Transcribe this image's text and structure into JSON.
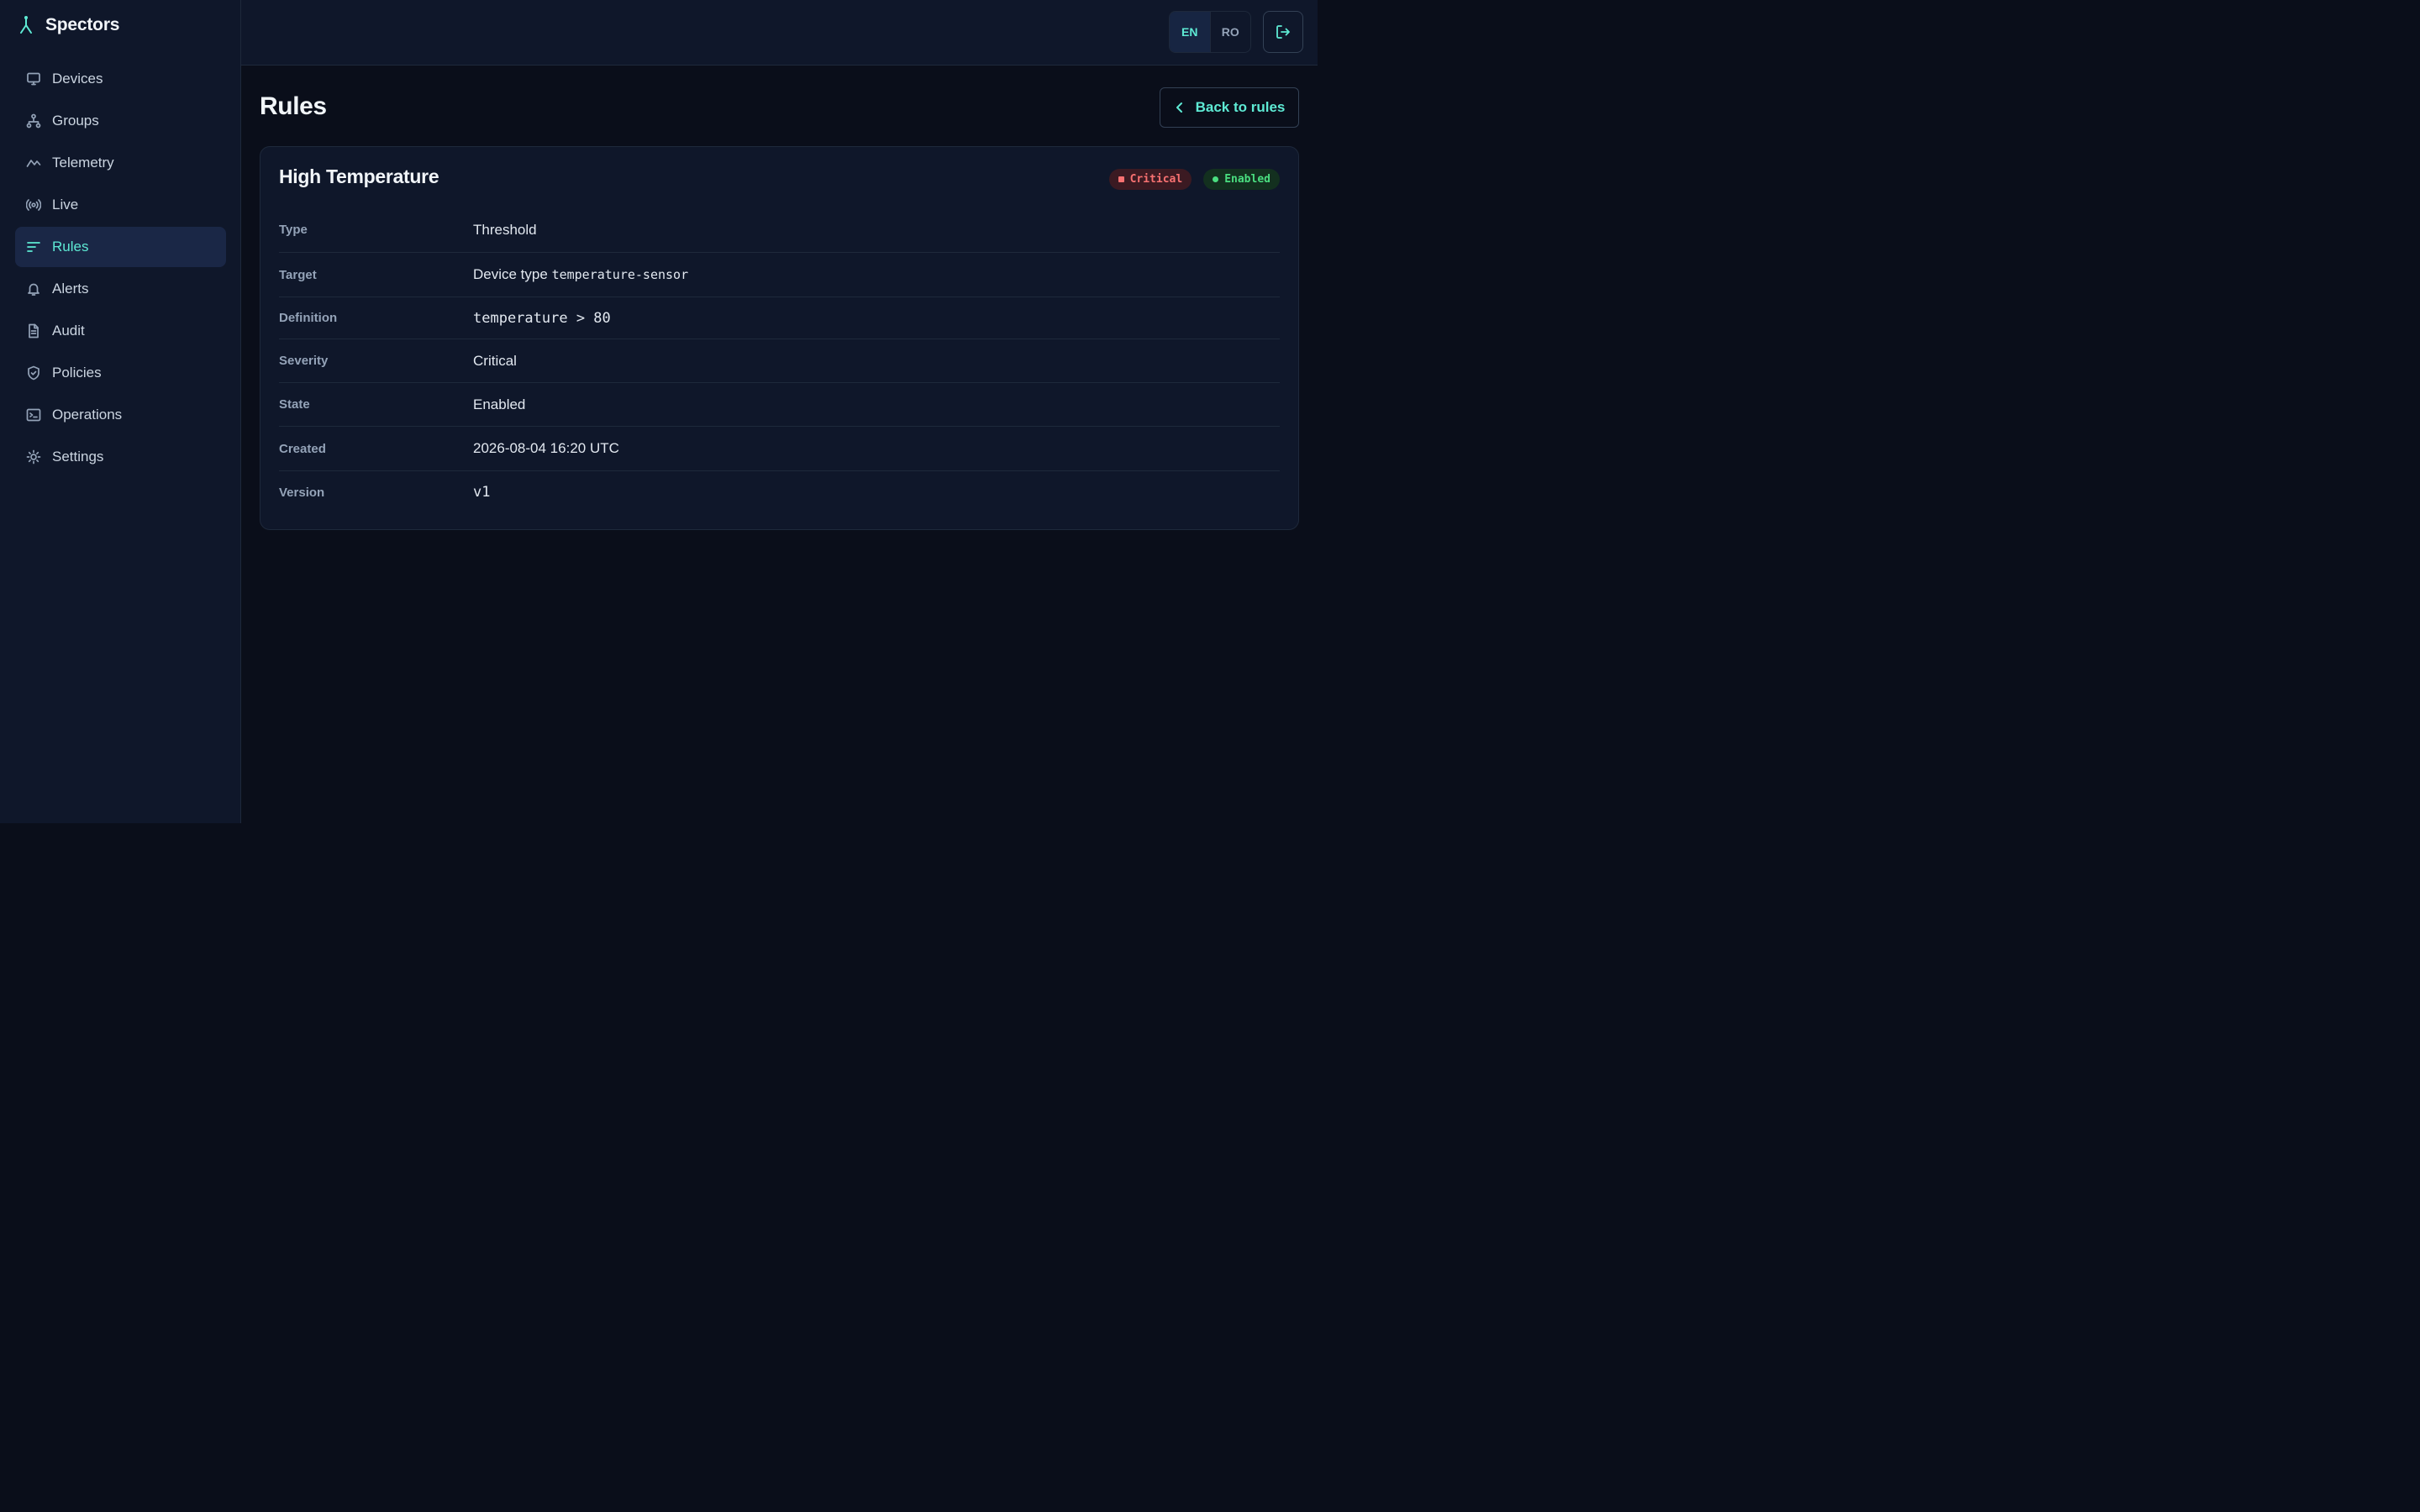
{
  "brand": {
    "name": "Spectors"
  },
  "sidebar": {
    "items": [
      {
        "label": "Devices",
        "icon": "monitor-icon",
        "active": false
      },
      {
        "label": "Groups",
        "icon": "hierarchy-icon",
        "active": false
      },
      {
        "label": "Telemetry",
        "icon": "activity-icon",
        "active": false
      },
      {
        "label": "Live",
        "icon": "broadcast-icon",
        "active": false
      },
      {
        "label": "Rules",
        "icon": "lines-icon",
        "active": true
      },
      {
        "label": "Alerts",
        "icon": "bell-icon",
        "active": false
      },
      {
        "label": "Audit",
        "icon": "document-icon",
        "active": false
      },
      {
        "label": "Policies",
        "icon": "shield-icon",
        "active": false
      },
      {
        "label": "Operations",
        "icon": "terminal-icon",
        "active": false
      },
      {
        "label": "Settings",
        "icon": "sun-gear-icon",
        "active": false
      }
    ]
  },
  "header": {
    "languages": [
      {
        "code": "EN",
        "active": true
      },
      {
        "code": "RO",
        "active": false
      }
    ],
    "logout_icon": "logout-icon"
  },
  "page": {
    "title": "Rules",
    "back_label": "Back to rules"
  },
  "rule": {
    "name": "High Temperature",
    "badges": {
      "severity": "Critical",
      "state": "Enabled"
    },
    "details": {
      "type": {
        "label": "Type",
        "value": "Threshold"
      },
      "target": {
        "label": "Target",
        "prefix": "Device type",
        "value": "temperature-sensor"
      },
      "definition": {
        "label": "Definition",
        "value": "temperature > 80"
      },
      "severity": {
        "label": "Severity",
        "value": "Critical"
      },
      "state": {
        "label": "State",
        "value": "Enabled"
      },
      "created": {
        "label": "Created",
        "value": "2026-08-04 16:20 UTC"
      },
      "version": {
        "label": "Version",
        "value": "v1"
      }
    }
  },
  "colors": {
    "accent": "#5eead4",
    "critical": "#f87171",
    "enabled": "#4ade80",
    "background": "#0a0e1a",
    "panel": "#0f172a"
  }
}
